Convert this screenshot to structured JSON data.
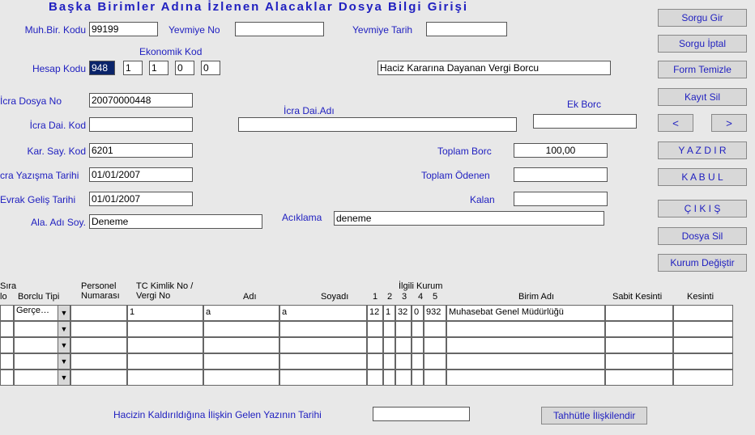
{
  "title": "Başka Birimler Adına İzlenen Alacaklar Dosya Bilgi Girişi",
  "labels": {
    "muh_bir_kodu": "Muh.Bir. Kodu",
    "yevmiye_no": "Yevmiye No",
    "yevmiye_tarih": "Yevmiye Tarih",
    "ekonomik_kod": "Ekonomik Kod",
    "hesap_kodu": "Hesap Kodu",
    "icra_dosya_no": "İcra Dosya No",
    "icra_dai_adi": "İcra Dai.Adı",
    "ek_borc": "Ek Borc",
    "icra_dai_kod": "İcra Dai. Kod",
    "kar_say_kod": "Kar. Say. Kod",
    "toplam_borc": "Toplam Borc",
    "toplam_odenen": "Toplam Ödenen",
    "kalan": "Kalan",
    "icra_yazisma_tarihi": "cra Yazışma Tarihi",
    "evrak_gelis_tarihi": "Evrak Geliş Tarihi",
    "ala_adi_soy": "Ala. Adı Soy.",
    "aciklama": "Acıklama",
    "hacizin_kaldirildigina": "Hacizin Kaldırıldığına İlişkin Gelen Yazının Tarihi"
  },
  "values": {
    "muh_bir_kodu": "99199",
    "yevmiye_no": "",
    "yevmiye_tarih": "",
    "hesap_kodu": "948",
    "ek1": "1",
    "ek2": "1",
    "ek3": "0",
    "ek4": "0",
    "hesap_desc": "Haciz Kararına Dayanan Vergi Borcu",
    "icra_dosya_no": "20070000448",
    "icra_dai_adi": "",
    "ek_borc": "",
    "icra_dai_kod": "",
    "kar_say_kod": "6201",
    "toplam_borc": "100,00",
    "toplam_odenen": "",
    "kalan": "",
    "icra_yazisma_tarihi": "01/01/2007",
    "evrak_gelis_tarihi": "01/01/2007",
    "ala_adi_soy": "Deneme",
    "aciklama": "deneme",
    "hacizin_tarihi": ""
  },
  "buttons": {
    "sorgu_gir": "Sorgu Gir",
    "sorgu_iptal": "Sorgu İptal",
    "form_temizle": "Form Temizle",
    "kayit_sil": "Kayıt Sil",
    "prev": "<",
    "next": ">",
    "yaz": "Y A Z D I R",
    "kabul": "K A B U L",
    "cikis": "Ç I K I Ş",
    "dosya_sil": "Dosya Sil",
    "kurum_degistir": "Kurum Değiştir",
    "tahhutle": "Tahhütle İlişkilendir"
  },
  "grid": {
    "headers": {
      "sira": "Sıra",
      "no": "lo",
      "borclu_tipi": "Borclu Tipi",
      "personel_numarasi": "Personel\nNumarası",
      "tc_kimlik": "TC Kimlik No /\nVergi No",
      "adi": "Adı",
      "soyadi": "Soyadı",
      "ilgili_kurum": "İlgili Kurum",
      "k1": "1",
      "k2": "2",
      "k3": "3",
      "k4": "4",
      "k5": "5",
      "birim_adi": "Birim Adı",
      "sabit_kesinti": "Sabit Kesinti",
      "kesinti": "Kesinti"
    },
    "rows": [
      {
        "borclu_tipi": "Gerçe…",
        "personel": "",
        "tc": "1",
        "adi": "a",
        "soyadi": "a",
        "k1": "12",
        "k2": "1",
        "k3": "32",
        "k4": "0",
        "k5": "932",
        "birim": "Muhasebat Genel Müdürlüğü",
        "sabit": "",
        "kesinti": ""
      },
      {
        "borclu_tipi": "",
        "personel": "",
        "tc": "",
        "adi": "",
        "soyadi": "",
        "k1": "",
        "k2": "",
        "k3": "",
        "k4": "",
        "k5": "",
        "birim": "",
        "sabit": "",
        "kesinti": ""
      },
      {
        "borclu_tipi": "",
        "personel": "",
        "tc": "",
        "adi": "",
        "soyadi": "",
        "k1": "",
        "k2": "",
        "k3": "",
        "k4": "",
        "k5": "",
        "birim": "",
        "sabit": "",
        "kesinti": ""
      },
      {
        "borclu_tipi": "",
        "personel": "",
        "tc": "",
        "adi": "",
        "soyadi": "",
        "k1": "",
        "k2": "",
        "k3": "",
        "k4": "",
        "k5": "",
        "birim": "",
        "sabit": "",
        "kesinti": ""
      },
      {
        "borclu_tipi": "",
        "personel": "",
        "tc": "",
        "adi": "",
        "soyadi": "",
        "k1": "",
        "k2": "",
        "k3": "",
        "k4": "",
        "k5": "",
        "birim": "",
        "sabit": "",
        "kesinti": ""
      }
    ]
  }
}
